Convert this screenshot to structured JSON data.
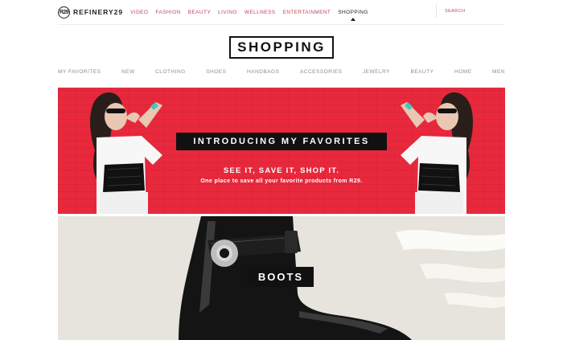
{
  "header": {
    "logo_text": "REFINERY29",
    "logo_mark": "R29",
    "nav_items": [
      {
        "label": "VIDEO"
      },
      {
        "label": "FASHION"
      },
      {
        "label": "BEAUTY"
      },
      {
        "label": "LIVING"
      },
      {
        "label": "WELLNESS"
      },
      {
        "label": "ENTERTAINMENT"
      },
      {
        "label": "SHOPPING"
      }
    ],
    "active_nav": "SHOPPING",
    "search_placeholder": "SEARCH"
  },
  "page_title": "SHOPPING",
  "categories": [
    {
      "label": "MY FAVORITES"
    },
    {
      "label": "NEW"
    },
    {
      "label": "CLOTHING"
    },
    {
      "label": "SHOES"
    },
    {
      "label": "HANDBAGS"
    },
    {
      "label": "ACCESSORIES"
    },
    {
      "label": "JEWELRY"
    },
    {
      "label": "BEAUTY"
    },
    {
      "label": "HOME"
    },
    {
      "label": "MEN"
    }
  ],
  "hero": {
    "label": "INTRODUCING MY FAVORITES",
    "tagline": "SEE IT, SAVE IT, SHOP IT.",
    "description": "One place to save all your favorite products from R29.",
    "background_color": "#e8283c"
  },
  "boots": {
    "label": "BOOTS",
    "background_color": "#e6e4dc"
  },
  "colors": {
    "accent": "#c0475a",
    "category_text": "#8d8d8d",
    "label_bg": "#111111"
  }
}
